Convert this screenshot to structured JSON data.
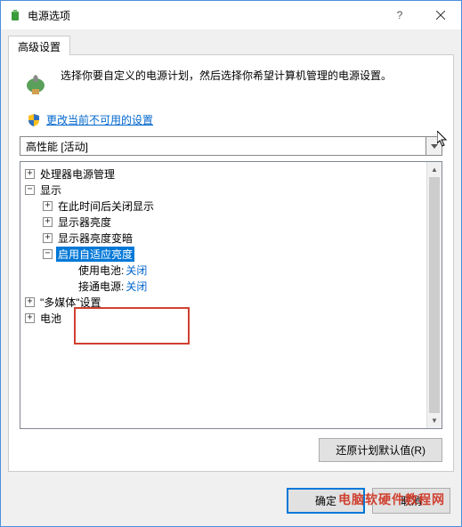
{
  "title": "电源选项",
  "tab": "高级设置",
  "description": "选择你要自定义的电源计划，然后选择你希望计算机管理的电源设置。",
  "change_link": "更改当前不可用的设置",
  "plan_dropdown": "高性能 [活动]",
  "tree": {
    "cpu": "处理器电源管理",
    "display": "显示",
    "display_off": "在此时间后关闭显示",
    "brightness": "显示器亮度",
    "dim": "显示器亮度变暗",
    "adaptive": "启用自适应亮度",
    "battery_label": "使用电池: ",
    "battery_val": "关闭",
    "plugged_label": "接通电源: ",
    "plugged_val": "关闭",
    "multimedia": "\"多媒体\"设置",
    "batt_node": "电池"
  },
  "restore_btn": "还原计划默认值(R)",
  "ok": "确定",
  "cancel": "取消",
  "watermark": "电脑软硬件教程网"
}
